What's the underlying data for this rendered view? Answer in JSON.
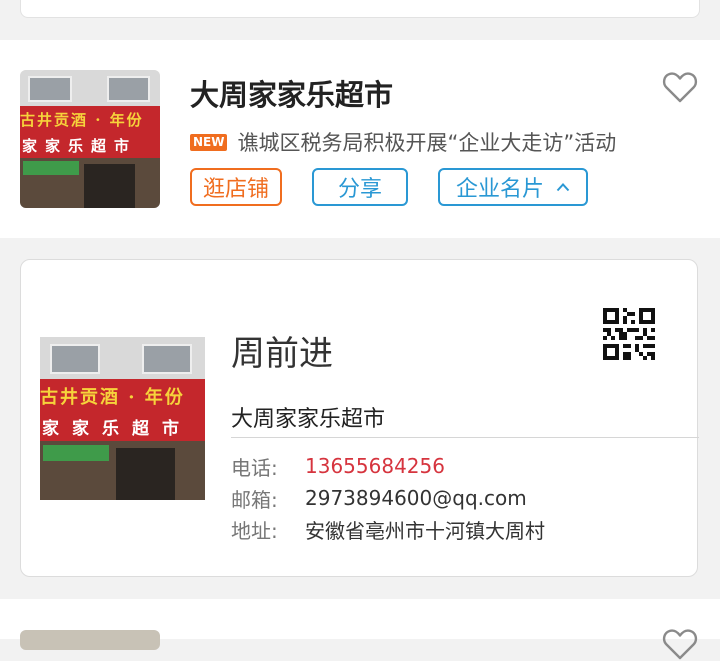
{
  "store": {
    "name": "大周家家乐超市",
    "news_badge": "NEW",
    "news_text": "谯城区税务局积极开展“企业大走访”活动",
    "image_sign_line1": "古井贡酒 · 年份",
    "image_sign_line2": "家家乐超市",
    "buttons": {
      "visit_store": "逛店铺",
      "share": "分享",
      "business_card": "企业名片"
    }
  },
  "business_card": {
    "person_name": "周前进",
    "company_name": "大周家家乐超市",
    "image_sign_line1": "古井贡酒 · 年份",
    "image_sign_line2": "家家乐超市",
    "phone_label": "电话:",
    "phone": "13655684256",
    "email_label": "邮箱:",
    "email": "2973894600@qq.com",
    "address_label": "地址:",
    "address": "安徽省亳州市十河镇大周村"
  },
  "colors": {
    "accent_orange": "#f06d1f",
    "accent_blue": "#2a98d4",
    "phone_red": "#d6343e"
  },
  "icons": [
    "heart-outline-icon",
    "chevron-up-icon",
    "qr-code-icon"
  ]
}
